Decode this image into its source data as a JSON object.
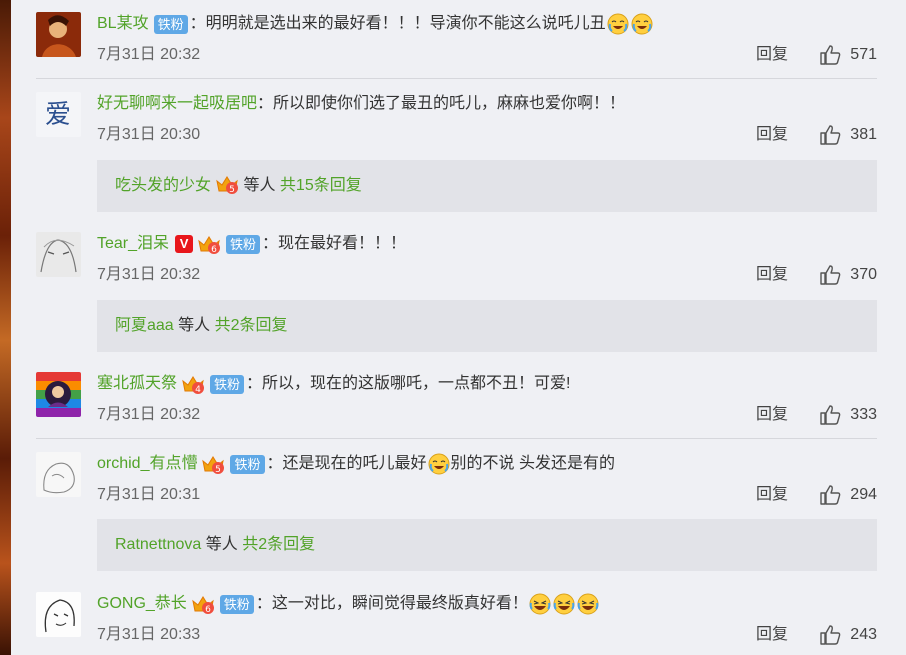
{
  "colors": {
    "username": "#52a329",
    "fan_badge": "#5fa8e6",
    "sub_bg": "#e2e3e8",
    "page_bg": "#eff0f4"
  },
  "labels": {
    "reply": "回复",
    "fan_badge": "铁粉",
    "v_badge": "V"
  },
  "comments": [
    {
      "user": "BL某攻",
      "text": "：明明就是选出来的最好看！！！导演你不能这么说吒儿丑",
      "time": "7月31日 20:32",
      "likes": "571",
      "emojis": [
        "cry-laugh-emoji",
        "cry-laugh-emoji"
      ]
    },
    {
      "user": "好无聊啊来一起吸居吧",
      "text": "：所以即使你们选了最丑的吒儿，麻麻也爱你啊！！",
      "time": "7月31日 20:30",
      "likes": "381",
      "sub": {
        "user": "吃头发的少女",
        "mid": " 等人 ",
        "total": "共15条回复",
        "vip_level": "5"
      }
    },
    {
      "user": "Tear_泪呆",
      "text": "：现在最好看！！！",
      "time": "7月31日 20:32",
      "likes": "370",
      "vip_level": "6",
      "sub": {
        "user": "阿夏aaa",
        "mid": " 等人 ",
        "total": "共2条回复"
      }
    },
    {
      "user": "塞北孤天祭",
      "text": "：所以，现在的这版哪吒，一点都不丑！可爱!",
      "time": "7月31日 20:32",
      "likes": "333",
      "vip_level": "4"
    },
    {
      "user": "orchid_有点懵",
      "text_a": "：还是现在的吒儿最好",
      "text_b": "别的不说 头发还是有的",
      "time": "7月31日 20:31",
      "likes": "294",
      "vip_level": "5",
      "sub": {
        "user": "Ratnettnova",
        "mid": " 等人 ",
        "total": "共2条回复"
      }
    },
    {
      "user": "GONG_恭长",
      "text": "：这一对比，瞬间觉得最终版真好看！",
      "time": "7月31日 20:33",
      "likes": "243",
      "vip_level": "6",
      "emojis": [
        "laugh-cry-emoji",
        "laugh-cry-emoji",
        "laugh-cry-emoji"
      ]
    }
  ]
}
